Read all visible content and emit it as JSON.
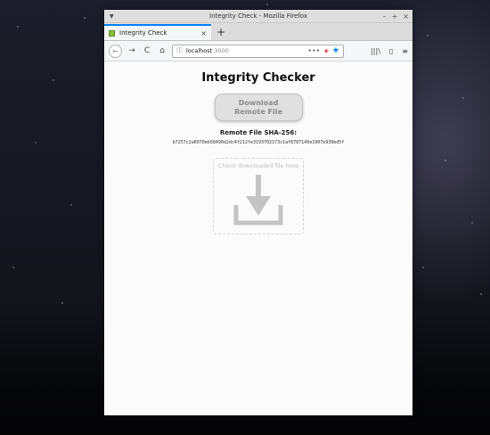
{
  "window": {
    "title": "Integrity Check - Mozilla Firefox",
    "controls": [
      "–",
      "+",
      "×"
    ]
  },
  "tab": {
    "label": "Integrity Check",
    "close": "×",
    "new_tab": "+"
  },
  "nav": {
    "back": "←",
    "forward": "→",
    "reload": "C",
    "home": "⌂",
    "url_host": "localhost",
    "url_port": ":3000",
    "page_actions": "•••",
    "library": "|||\\",
    "sidebar": "▯",
    "menu": "≡"
  },
  "page": {
    "title": "Integrity Checker",
    "download_button": "Download Remote File",
    "sha_label": "Remote File SHA-256:",
    "sha_value": "b7257c2a6070eb58490d2dc4f212fe3193702173c1af8787149e1907e939bd5f",
    "dropzone_label": "Check downloaded file here"
  },
  "colors": {
    "accent": "#0a84ff",
    "button_bg": "#e0e0e0",
    "icon_gray": "#c4c4c4"
  }
}
